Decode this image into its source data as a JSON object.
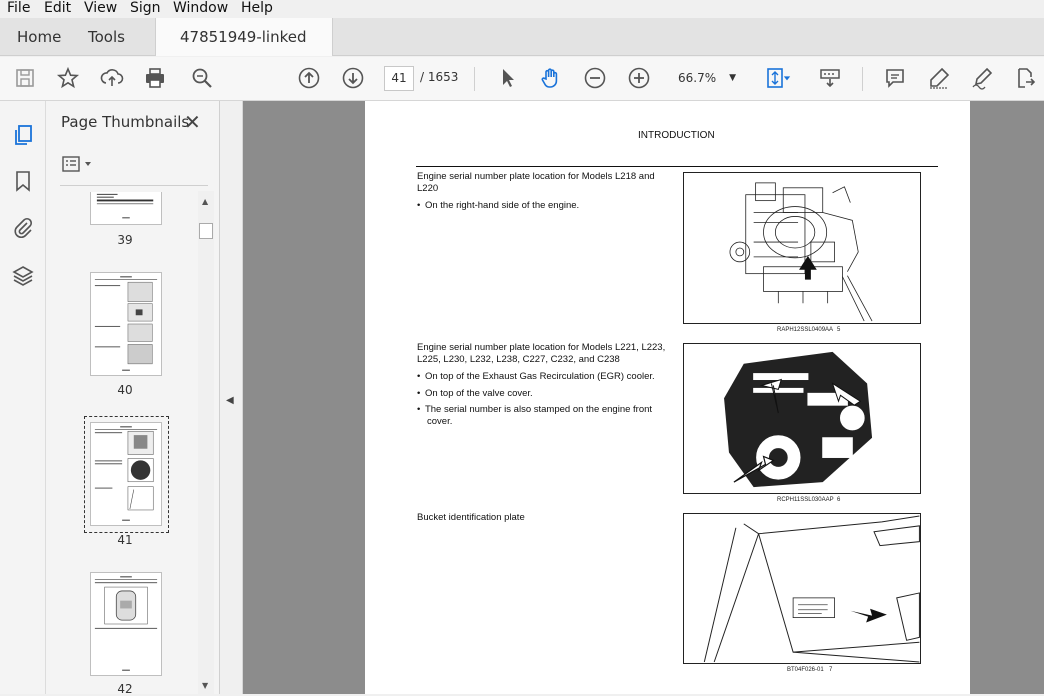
{
  "menu": [
    "File",
    "Edit",
    "View",
    "Sign",
    "Window",
    "Help"
  ],
  "tabs": {
    "home": "Home",
    "tools": "Tools",
    "document": "47851949-linked p..."
  },
  "toolbar": {
    "current_page": "41",
    "total_pages": "/  1653",
    "zoom": "66.7%"
  },
  "panel": {
    "title": "Page Thumbnails",
    "thumbnails": [
      "39",
      "40",
      "41",
      "42"
    ]
  },
  "document": {
    "header": "INTRODUCTION",
    "section1": {
      "title": "Engine serial number plate location for Models L218 and L220",
      "bullets": [
        "On the right-hand side of the engine."
      ],
      "caption": "RAPH12SSL0409AA",
      "fig": "5"
    },
    "section2": {
      "title": "Engine serial number plate location for Models L221, L223, L225, L230, L232, L238, C227, C232, and C238",
      "bullets": [
        "On top of the Exhaust Gas Recirculation (EGR) cooler.",
        "On top of the valve cover.",
        "The serial number is also stamped on the engine front cover."
      ],
      "caption": "RCPH11SSL030AAP",
      "fig": "6"
    },
    "section3": {
      "title": "Bucket identification plate",
      "caption": "BT04F026-01",
      "fig": "7"
    }
  },
  "icons": [
    "save-icon",
    "bookmark-star-icon",
    "upload-icon",
    "print-icon",
    "find-icon",
    "prev-page-icon",
    "next-page-icon",
    "select-cursor-icon",
    "hand-tool-icon",
    "zoom-out-icon",
    "zoom-in-icon",
    "fit-page-icon",
    "scroll-mode-icon",
    "comment-icon",
    "highlight-icon",
    "sign-icon",
    "export-icon"
  ]
}
